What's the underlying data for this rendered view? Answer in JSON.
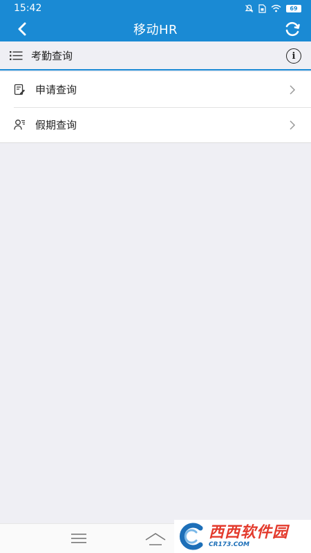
{
  "status_bar": {
    "time": "15:42",
    "battery": "69",
    "icons": [
      "mute-icon",
      "sim-icon",
      "wifi-icon",
      "battery-icon"
    ]
  },
  "header": {
    "title": "移动HR",
    "back_icon": "chevron-left-icon",
    "refresh_icon": "refresh-icon"
  },
  "section": {
    "label": "考勤查询",
    "info_symbol": "i"
  },
  "menu": {
    "items": [
      {
        "label": "申请查询",
        "icon": "edit-document-icon"
      },
      {
        "label": "假期查询",
        "icon": "user-list-icon"
      }
    ]
  },
  "watermark": {
    "main": "西西软件园",
    "sub": "CR173.COM"
  },
  "colors": {
    "accent": "#1a8ad4",
    "background": "#efeff4",
    "watermark_red": "#e33a2c"
  }
}
